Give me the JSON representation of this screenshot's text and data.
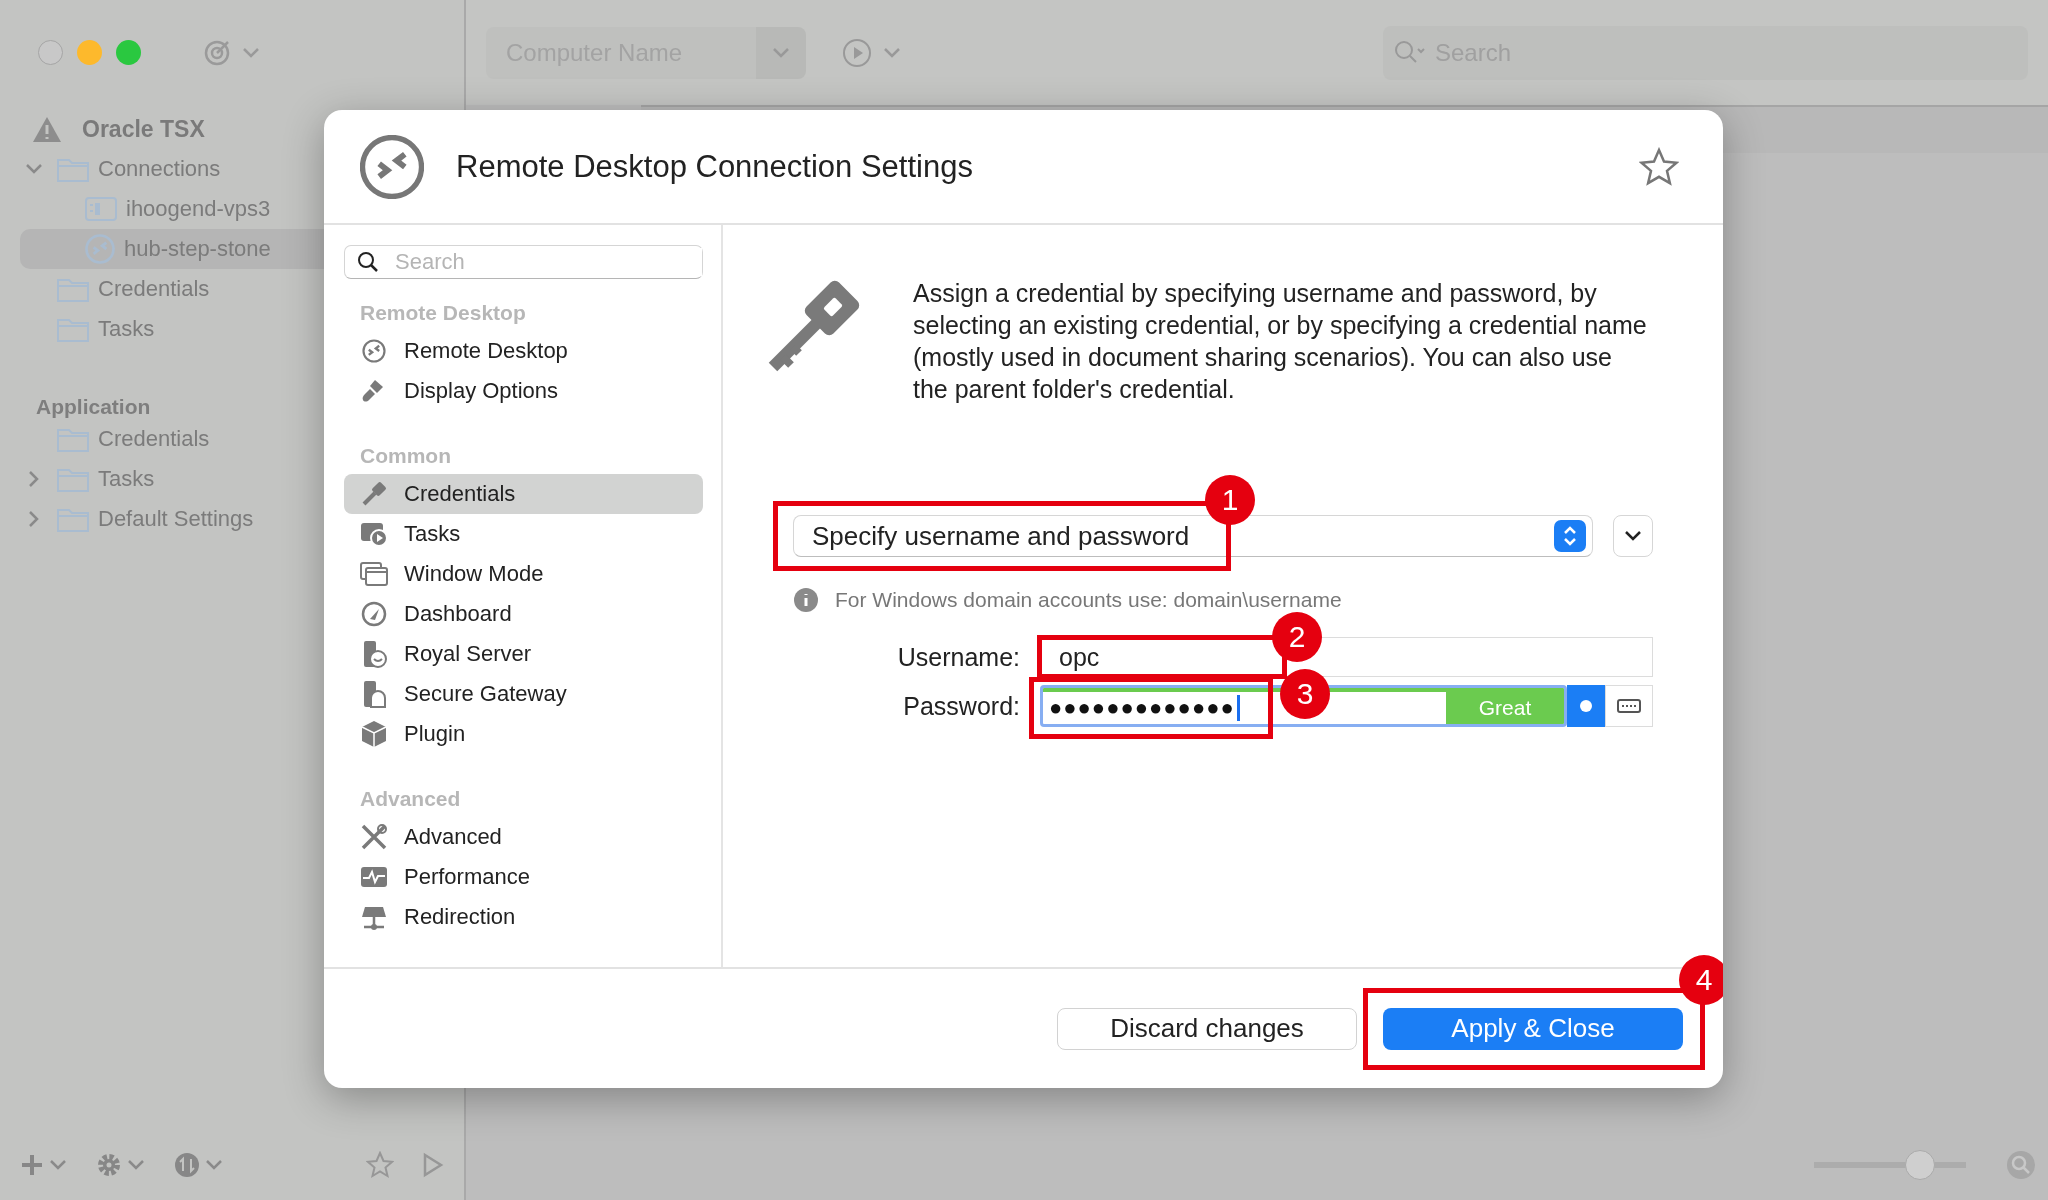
{
  "toolbar": {
    "computer_name": {
      "placeholder": "Computer Name"
    },
    "search": {
      "placeholder": "Search"
    }
  },
  "sidebar": {
    "groups": [
      {
        "title": "Oracle TSX",
        "kind": "document",
        "items": [
          {
            "label": "Connections",
            "kind": "folder",
            "expanded": true,
            "selected": false,
            "children": [
              {
                "label": "ihoogend-vps3",
                "kind": "terminal",
                "selected": false
              },
              {
                "label": "hub-step-stone",
                "kind": "rdp",
                "selected": true
              }
            ]
          },
          {
            "label": "Credentials",
            "kind": "folder",
            "selected": false
          },
          {
            "label": "Tasks",
            "kind": "folder",
            "selected": false
          }
        ]
      },
      {
        "title": "Application",
        "kind": "section",
        "items": [
          {
            "label": "Credentials",
            "kind": "folder",
            "selected": false
          },
          {
            "label": "Tasks",
            "kind": "folder",
            "expanded": false,
            "selected": false
          },
          {
            "label": "Default Settings",
            "kind": "folder",
            "expanded": false,
            "selected": false
          }
        ]
      }
    ]
  },
  "zoom_slider": {
    "level": 0.7
  },
  "dialog": {
    "title": "Remote Desktop Connection Settings",
    "search": {
      "placeholder": "Search"
    },
    "nav": [
      {
        "title": "Remote Desktop",
        "items": [
          {
            "label": "Remote Desktop",
            "kind": "rdp",
            "selected": false
          },
          {
            "label": "Display Options",
            "kind": "brush",
            "selected": false
          }
        ]
      },
      {
        "title": "Common",
        "items": [
          {
            "label": "Credentials",
            "kind": "key",
            "selected": true
          },
          {
            "label": "Tasks",
            "kind": "tasks",
            "selected": false
          },
          {
            "label": "Window Mode",
            "kind": "window",
            "selected": false
          },
          {
            "label": "Dashboard",
            "kind": "gauge",
            "selected": false
          },
          {
            "label": "Royal Server",
            "kind": "server",
            "selected": false
          },
          {
            "label": "Secure Gateway",
            "kind": "gateway",
            "selected": false
          },
          {
            "label": "Plugin",
            "kind": "cube",
            "selected": false
          }
        ]
      },
      {
        "title": "Advanced",
        "items": [
          {
            "label": "Advanced",
            "kind": "tools",
            "selected": false
          },
          {
            "label": "Performance",
            "kind": "pulse",
            "selected": false
          },
          {
            "label": "Redirection",
            "kind": "network",
            "selected": false
          }
        ]
      }
    ],
    "description": "Assign a credential by specifying username and password, by selecting an existing credential, or by specifying a credential name (mostly used in document sharing scenarios). You can also use the parent folder's credential.",
    "credential_mode": {
      "value": "Specify username and password",
      "callout": "1"
    },
    "hint": "For Windows domain accounts use: domain\\username",
    "username": {
      "label": "Username:",
      "value": "opc",
      "callout": "2"
    },
    "password": {
      "label": "Password:",
      "value": "●●●●●●●●●●●●●",
      "callout": "3",
      "strength": {
        "label": "Great",
        "level": 1
      },
      "reveal": true
    },
    "buttons": [
      {
        "label": "Discard changes",
        "kind": "default"
      },
      {
        "label": "Apply & Close",
        "kind": "primary",
        "callout": "4"
      }
    ]
  }
}
